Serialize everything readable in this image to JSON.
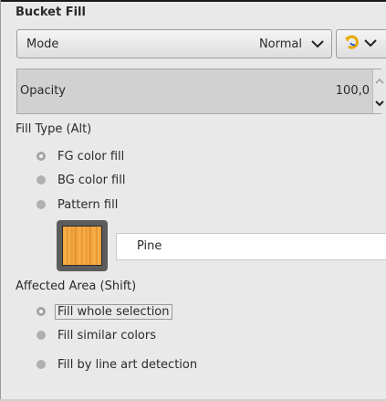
{
  "panel": {
    "title": "Bucket Fill"
  },
  "mode": {
    "label": "Mode",
    "value": "Normal"
  },
  "opacity": {
    "label": "Opacity",
    "value": "100,0"
  },
  "fill_type": {
    "label": "Fill Type  (Alt)",
    "options": [
      {
        "label": "FG color fill",
        "selected": true
      },
      {
        "label": "BG color fill",
        "selected": false
      },
      {
        "label": "Pattern fill",
        "selected": false
      }
    ]
  },
  "pattern": {
    "name": "Pine"
  },
  "affected_area": {
    "label": "Affected Area  (Shift)",
    "options": [
      {
        "label": "Fill whole selection",
        "selected": true
      },
      {
        "label": "Fill similar colors",
        "selected": false
      },
      {
        "label": "Fill by line art detection",
        "selected": false
      }
    ]
  },
  "colors": {
    "background": "#e9e9e9",
    "reset_icon_yellow": "#e8a800",
    "reset_icon_blue": "#2f5fc4"
  }
}
